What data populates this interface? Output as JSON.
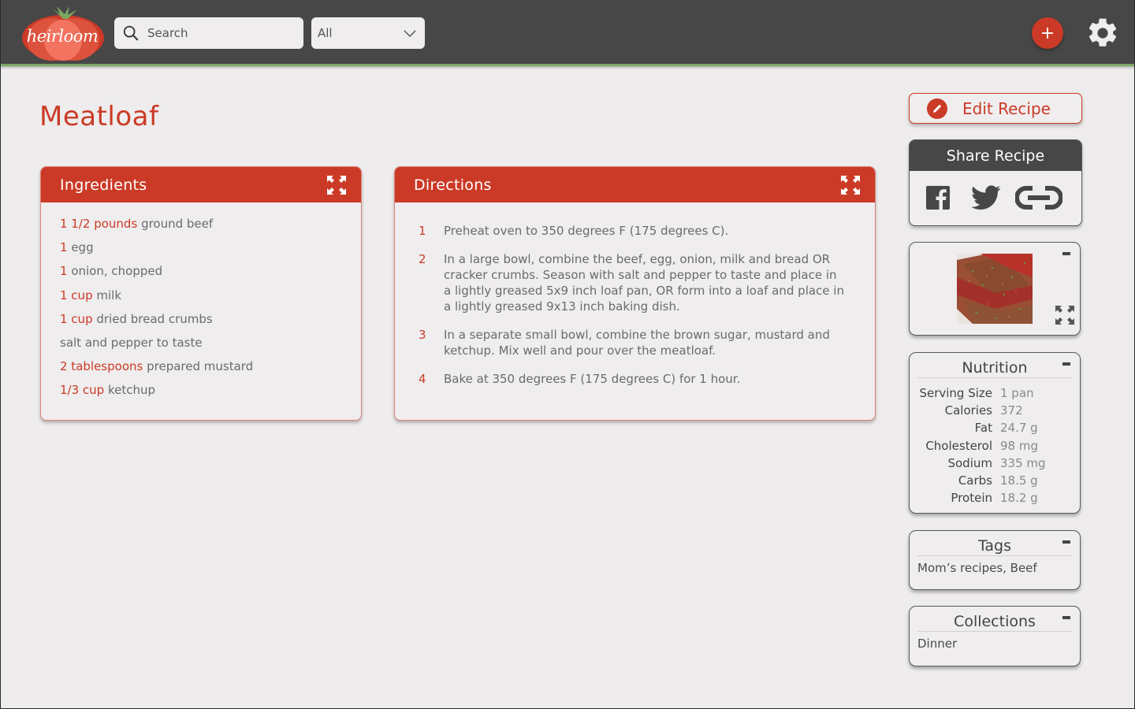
{
  "header": {
    "logo_text": "heirloom",
    "search": {
      "placeholder": "Search",
      "value": ""
    },
    "filter": {
      "selected": "All"
    },
    "add_label": "+",
    "colors": {
      "bar": "#474747",
      "accent_line": "#7aa962",
      "brand_red": "#cb3a26"
    }
  },
  "recipe": {
    "title": "Meatloaf"
  },
  "ingredients": {
    "title": "Ingredients",
    "items": [
      {
        "qty": "1 1/2 pounds",
        "name": "ground beef"
      },
      {
        "qty": "1",
        "name": "egg"
      },
      {
        "qty": "1",
        "name": "onion, chopped"
      },
      {
        "qty": "1 cup",
        "name": "milk"
      },
      {
        "qty": "1 cup",
        "name": "dried bread crumbs"
      },
      {
        "qty": "",
        "name": "salt and pepper to taste"
      },
      {
        "qty": "2 tablespoons",
        "name": "prepared mustard"
      },
      {
        "qty": "1/3 cup",
        "name": "ketchup"
      }
    ]
  },
  "directions": {
    "title": "Directions",
    "steps": [
      {
        "num": "1",
        "text": "Preheat oven to 350 degrees F (175 degrees C)."
      },
      {
        "num": "2",
        "text": "In a large bowl, combine the beef, egg, onion, milk and bread OR cracker crumbs. Season with salt and pepper to taste and place in a lightly greased 5x9 inch loaf pan, OR form into a loaf and place in a lightly greased 9x13 inch baking dish."
      },
      {
        "num": "3",
        "text": "In a separate small bowl, combine the brown sugar, mustard and ketchup. Mix well and pour over the meatloaf."
      },
      {
        "num": "4",
        "text": "Bake at 350 degrees F (175 degrees C) for 1 hour."
      }
    ]
  },
  "sidebar": {
    "edit_label": "Edit Recipe",
    "share": {
      "title": "Share Recipe",
      "icons": [
        "facebook-icon",
        "twitter-icon",
        "link-icon"
      ]
    },
    "photo_alt": "Meatloaf slices",
    "collapse_label": "-",
    "nutrition": {
      "title": "Nutrition",
      "rows": [
        {
          "label": "Serving Size",
          "value": "1 pan"
        },
        {
          "label": "Calories",
          "value": "372"
        },
        {
          "label": "Fat",
          "value": "24.7 g"
        },
        {
          "label": "Cholesterol",
          "value": "98 mg"
        },
        {
          "label": "Sodium",
          "value": "335 mg"
        },
        {
          "label": "Carbs",
          "value": "18.5 g"
        },
        {
          "label": "Protein",
          "value": "18.2 g"
        }
      ]
    },
    "tags": {
      "title": "Tags",
      "value": "Mom’s recipes, Beef"
    },
    "collections": {
      "title": "Collections",
      "value": "Dinner"
    }
  }
}
